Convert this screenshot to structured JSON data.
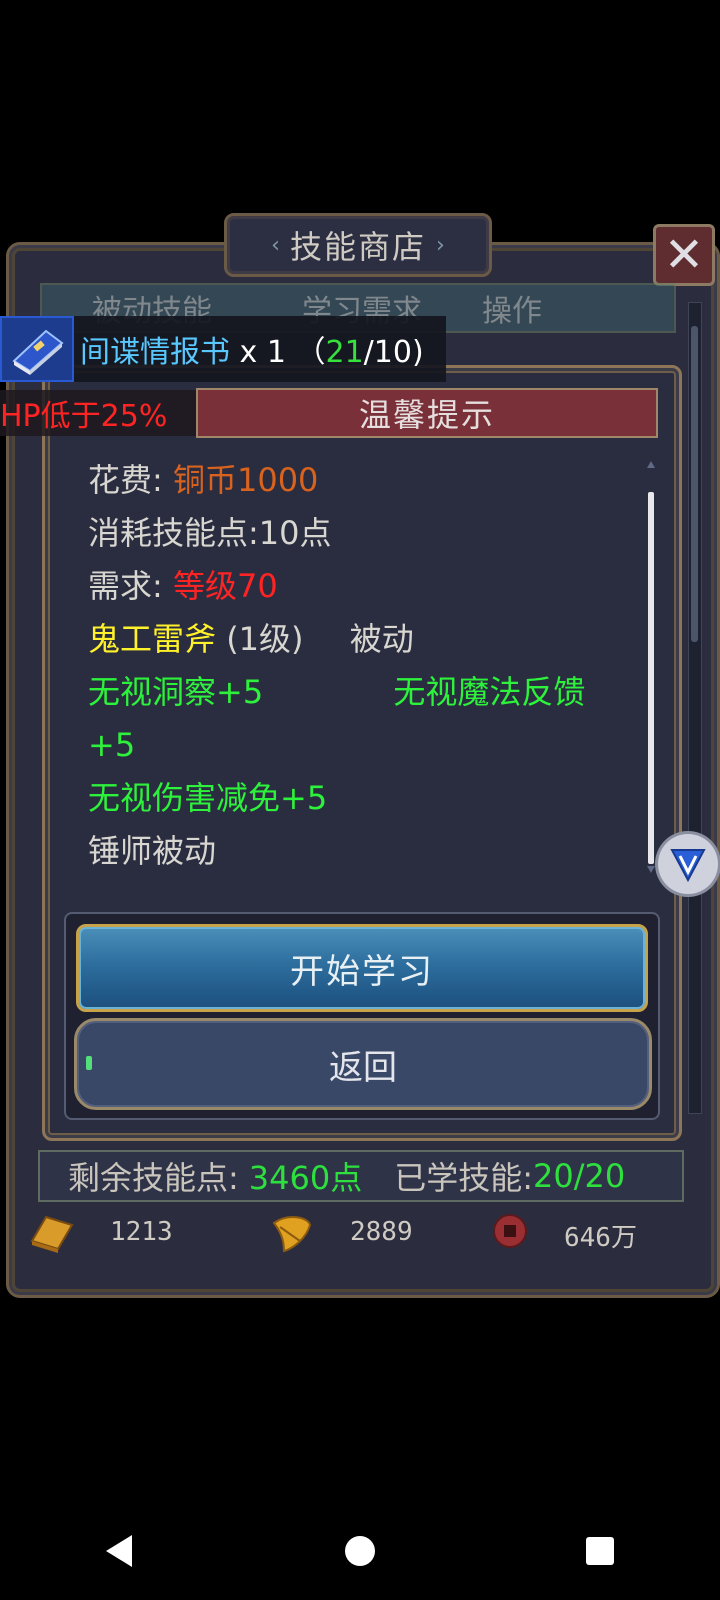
{
  "shop": {
    "title": "技能商店",
    "header": {
      "col1": "被动技能",
      "col2": "学习需求",
      "col3": "操作"
    }
  },
  "notification": {
    "item_name": "间谍情报书",
    "quantity": "x 1",
    "count_open": "（",
    "count_have": "21",
    "count_need": "/10)",
    "hp_warning": "HP低于25%"
  },
  "dialog": {
    "title": "温馨提示",
    "cost_label": "花费:",
    "cost_value": "铜币1000",
    "skill_points": "消耗技能点:10点",
    "require_label": "需求:",
    "require_value": "等级70",
    "skill_name": "鬼工雷斧",
    "skill_level": "(1级)",
    "skill_type": "被动",
    "effect1": "无视洞察+5",
    "effect2a": "无视魔法反馈",
    "effect2b": "+5",
    "effect3": "无视伤害减免+5",
    "description": "锤师被动",
    "learn_button": "开始学习",
    "back_button": "返回"
  },
  "stats": {
    "remaining_label": "剩余技能点:",
    "remaining_value": "3460点",
    "learned_label": "已学技能:",
    "learned_value": "20/20"
  },
  "currency": {
    "gold": "1213",
    "leaf": "2889",
    "coin": "646万"
  },
  "icons": {
    "item": "blue-book-icon",
    "close": "close-icon",
    "gold": "gold-ingot-icon",
    "leaf": "leaf-icon",
    "coin": "copper-coin-icon",
    "floating": "v-shield-icon"
  }
}
